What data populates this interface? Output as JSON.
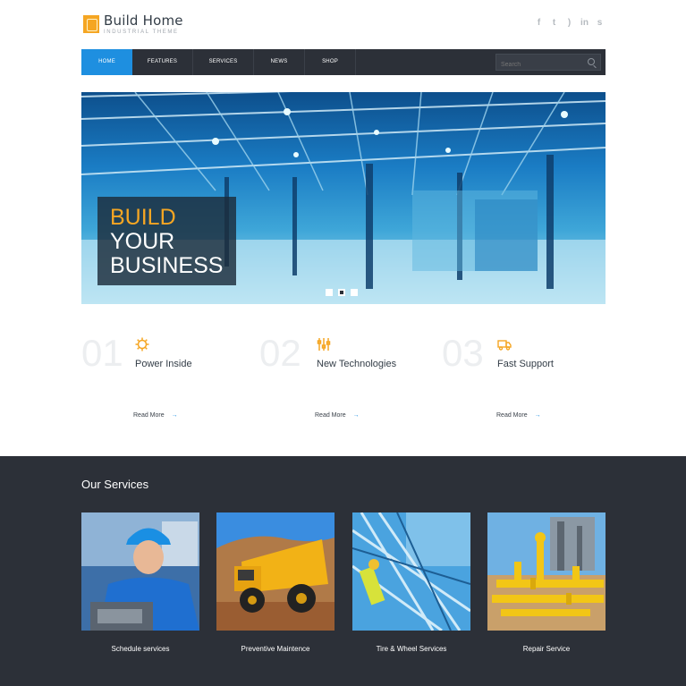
{
  "header": {
    "logo_title": "Build Home",
    "logo_subtitle": "INDUSTRIAL THEME",
    "social_icons": [
      "facebook-icon",
      "twitter-icon",
      "rss-icon",
      "linkedin-icon",
      "skype-icon"
    ]
  },
  "nav": {
    "items": [
      {
        "label": "HOME",
        "active": true
      },
      {
        "label": "FEATURES",
        "active": false
      },
      {
        "label": "SERVICES",
        "active": false
      },
      {
        "label": "NEWS",
        "active": false
      },
      {
        "label": "SHOP",
        "active": false
      }
    ],
    "search_placeholder": "Search"
  },
  "hero": {
    "line1": "BUILD",
    "line2": "YOUR",
    "line3": "BUSINESS",
    "slides": 3,
    "active_slide": 2
  },
  "features": [
    {
      "number": "01",
      "icon": "gear-icon",
      "title": "Power Inside",
      "link": "Read More"
    },
    {
      "number": "02",
      "icon": "tools-icon",
      "title": "New Technologies",
      "link": "Read More"
    },
    {
      "number": "03",
      "icon": "truck-icon",
      "title": "Fast Support",
      "link": "Read More"
    }
  ],
  "services": {
    "title": "Our Services",
    "items": [
      {
        "label": "Schedule services"
      },
      {
        "label": "Preventive Maintence"
      },
      {
        "label": "Tire & Wheel Services"
      },
      {
        "label": "Repair Service"
      }
    ]
  },
  "colors": {
    "accent": "#1e8fe0",
    "brand_orange": "#f5a623",
    "dark": "#2c3038"
  }
}
